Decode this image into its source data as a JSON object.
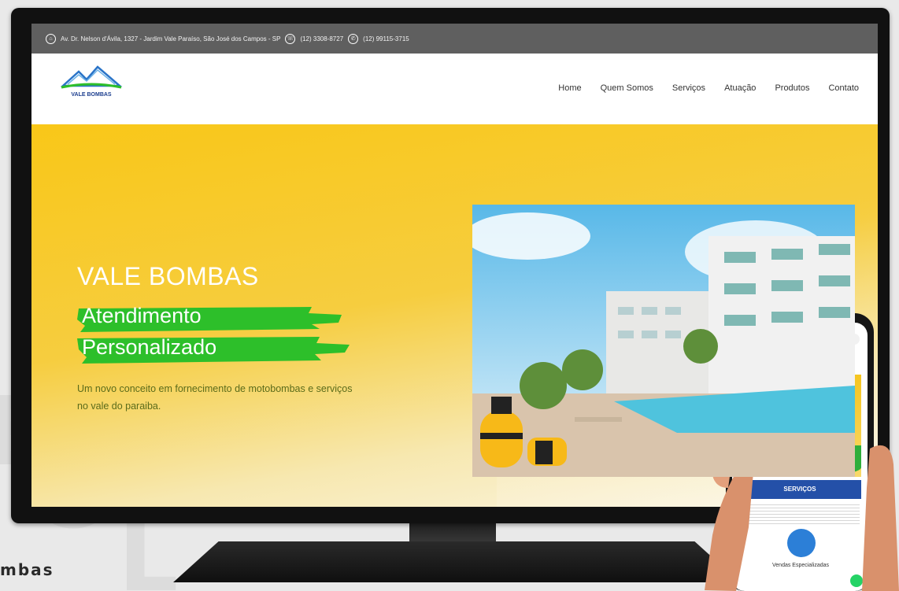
{
  "topbar": {
    "address": "Av. Dr. Nelson d'Ávila, 1327 - Jardim Vale Paraíso, São José dos Campos - SP",
    "phone": "(12) 3308-8727",
    "whatsapp": "(12) 99115-3715"
  },
  "logo": {
    "text": "VALE BOMBAS"
  },
  "nav": {
    "items": [
      "Home",
      "Quem Somos",
      "Serviços",
      "Atuação",
      "Produtos",
      "Contato"
    ]
  },
  "hero": {
    "title": "VALE BOMBAS",
    "subtitle_line1": "Atendimento",
    "subtitle_line2": "Personalizado",
    "description": "Um novo conceito em fornecimento de motobombas e serviços no vale do paraiba."
  },
  "phone": {
    "services_label": "SERVIÇOS",
    "card_caption": "Vendas Especializadas"
  },
  "caption": {
    "text": "mbas"
  },
  "colors": {
    "hero_yellow": "#f9c718",
    "brush_green": "#2dbf2a",
    "topbar_gray": "#5f5f5f",
    "services_blue": "#2450a8"
  }
}
